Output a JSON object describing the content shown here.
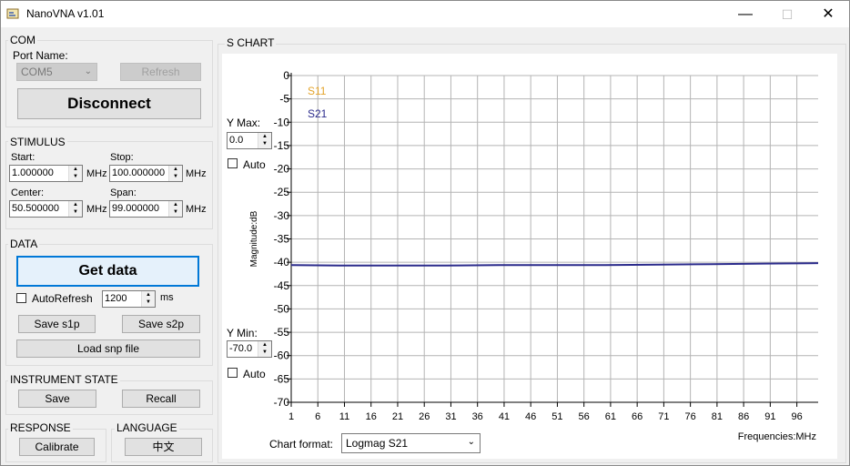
{
  "window": {
    "title": "NanoVNA v1.01",
    "min_label": "—",
    "max_label": "☐",
    "close_label": "✕"
  },
  "com": {
    "title": "COM",
    "port_label": "Port Name:",
    "port_value": "COM5",
    "refresh_label": "Refresh",
    "disconnect_label": "Disconnect"
  },
  "stimulus": {
    "title": "STIMULUS",
    "start_label": "Start:",
    "start_value": "1.000000",
    "start_unit": "MHz",
    "stop_label": "Stop:",
    "stop_value": "100.000000",
    "stop_unit": "MHz",
    "center_label": "Center:",
    "center_value": "50.500000",
    "center_unit": "MHz",
    "span_label": "Span:",
    "span_value": "99.000000",
    "span_unit": "MHz"
  },
  "data": {
    "title": "DATA",
    "get_data_label": "Get data",
    "autorefresh_label": "AutoRefresh",
    "autorefresh_value": "1200",
    "autorefresh_unit": "ms",
    "save_s1p_label": "Save s1p",
    "save_s2p_label": "Save s2p",
    "load_snp_label": "Load snp file"
  },
  "instrument_state": {
    "title": "INSTRUMENT STATE",
    "save_label": "Save",
    "recall_label": "Recall"
  },
  "response": {
    "title": "RESPONSE",
    "calibrate_label": "Calibrate"
  },
  "language": {
    "title": "LANGUAGE",
    "button_label": "中文"
  },
  "chart": {
    "title": "S CHART",
    "ymax_label": "Y Max:",
    "ymax_value": "0.0",
    "ymax_auto_label": "Auto",
    "ymin_label": "Y Min:",
    "ymin_value": "-70.0",
    "ymin_auto_label": "Auto",
    "chart_format_label": "Chart format:",
    "chart_format_value": "Logmag S21",
    "colors": {
      "s11": "#e3a32a",
      "s21": "#2b2b8c",
      "grid": "#b4b4b4"
    }
  },
  "chart_data": {
    "type": "line",
    "xlabel": "Frequencies:MHz",
    "ylabel": "Magnitude:dB",
    "xlim": [
      1,
      100
    ],
    "ylim": [
      -70,
      0
    ],
    "x_ticks": [
      1,
      6,
      11,
      16,
      21,
      26,
      31,
      36,
      41,
      46,
      51,
      56,
      61,
      66,
      71,
      76,
      81,
      86,
      91,
      96
    ],
    "y_ticks": [
      0,
      -5,
      -10,
      -15,
      -20,
      -25,
      -30,
      -35,
      -40,
      -45,
      -50,
      -55,
      -60,
      -65,
      -70
    ],
    "grid": true,
    "legend": [
      "S11",
      "S21"
    ],
    "series": [
      {
        "name": "S21",
        "x": [
          1,
          10,
          20,
          30,
          40,
          50,
          60,
          70,
          80,
          90,
          100
        ],
        "values": [
          -40.6,
          -40.7,
          -40.7,
          -40.7,
          -40.6,
          -40.6,
          -40.6,
          -40.5,
          -40.4,
          -40.3,
          -40.2
        ]
      }
    ]
  }
}
